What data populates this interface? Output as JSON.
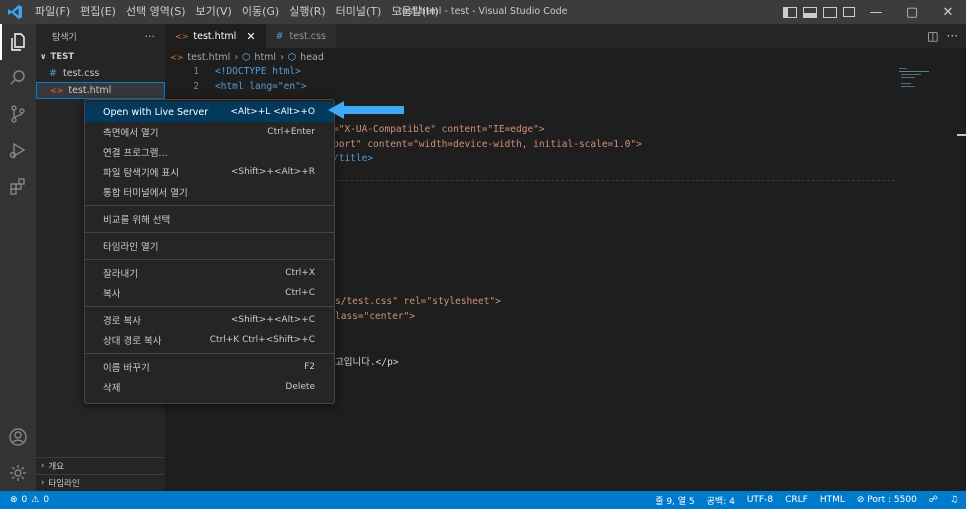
{
  "window": {
    "title": "test.html - test - Visual Studio Code"
  },
  "menubar": {
    "items": [
      "파일(F)",
      "편집(E)",
      "선택 영역(S)",
      "보기(V)",
      "이동(G)",
      "실행(R)",
      "터미널(T)",
      "도움말(H)"
    ]
  },
  "sidebar": {
    "header": "탐색기",
    "more": "···",
    "folder": "TEST",
    "files": [
      {
        "icon": "#",
        "name": "test.css"
      },
      {
        "icon": "<>",
        "name": "test.html"
      }
    ],
    "bottom_sections": [
      "개요",
      "타임라인"
    ]
  },
  "tabs": [
    {
      "icon": "<>",
      "label": "test.html",
      "close": "✕"
    },
    {
      "icon": "#",
      "label": "test.css"
    }
  ],
  "breadcrumb": [
    "test.html",
    "html",
    "head"
  ],
  "editor": {
    "lines": [
      {
        "n": "1",
        "code": "<!DOCTYPE html>"
      },
      {
        "n": "2",
        "code": "<html lang=\"en\">"
      }
    ],
    "visible_fragments": [
      "=\"X-UA-Compatible\" content=\"IE=edge\">",
      "port\" content=\"width=device-width, initial-scale=1.0\">",
      "/title>",
      "s/test.css\" rel=\"stylesheet\">",
      "lass=\"center\">",
      "고입니다.</p>"
    ]
  },
  "context_menu": {
    "groups": [
      [
        {
          "label": "Open with Live Server",
          "shortcut": "<Alt>+L <Alt>+O",
          "highlighted": true
        },
        {
          "label": "측면에서 열기",
          "shortcut": "Ctrl+Enter"
        },
        {
          "label": "연결 프로그램...",
          "shortcut": ""
        },
        {
          "label": "파일 탐색기에 표시",
          "shortcut": "<Shift>+<Alt>+R"
        },
        {
          "label": "통합 터미널에서 열기",
          "shortcut": ""
        }
      ],
      [
        {
          "label": "비교를 위해 선택",
          "shortcut": ""
        }
      ],
      [
        {
          "label": "타임라인 열기",
          "shortcut": ""
        }
      ],
      [
        {
          "label": "잘라내기",
          "shortcut": "Ctrl+X"
        },
        {
          "label": "복사",
          "shortcut": "Ctrl+C"
        }
      ],
      [
        {
          "label": "경로 복사",
          "shortcut": "<Shift>+<Alt>+C"
        },
        {
          "label": "상대 경로 복사",
          "shortcut": "Ctrl+K Ctrl+<Shift>+C"
        }
      ],
      [
        {
          "label": "이름 바꾸기",
          "shortcut": "F2"
        },
        {
          "label": "삭제",
          "shortcut": "Delete"
        }
      ]
    ]
  },
  "statusbar": {
    "errors": "0",
    "warnings": "0",
    "position": "줄 9, 열 5",
    "spaces": "공백: 4",
    "encoding": "UTF-8",
    "eol": "CRLF",
    "language": "HTML",
    "port": "Port : 5500"
  },
  "colors": {
    "accent": "#007acc",
    "menu_highlight": "#04395e",
    "arrow": "#3da9f5"
  }
}
